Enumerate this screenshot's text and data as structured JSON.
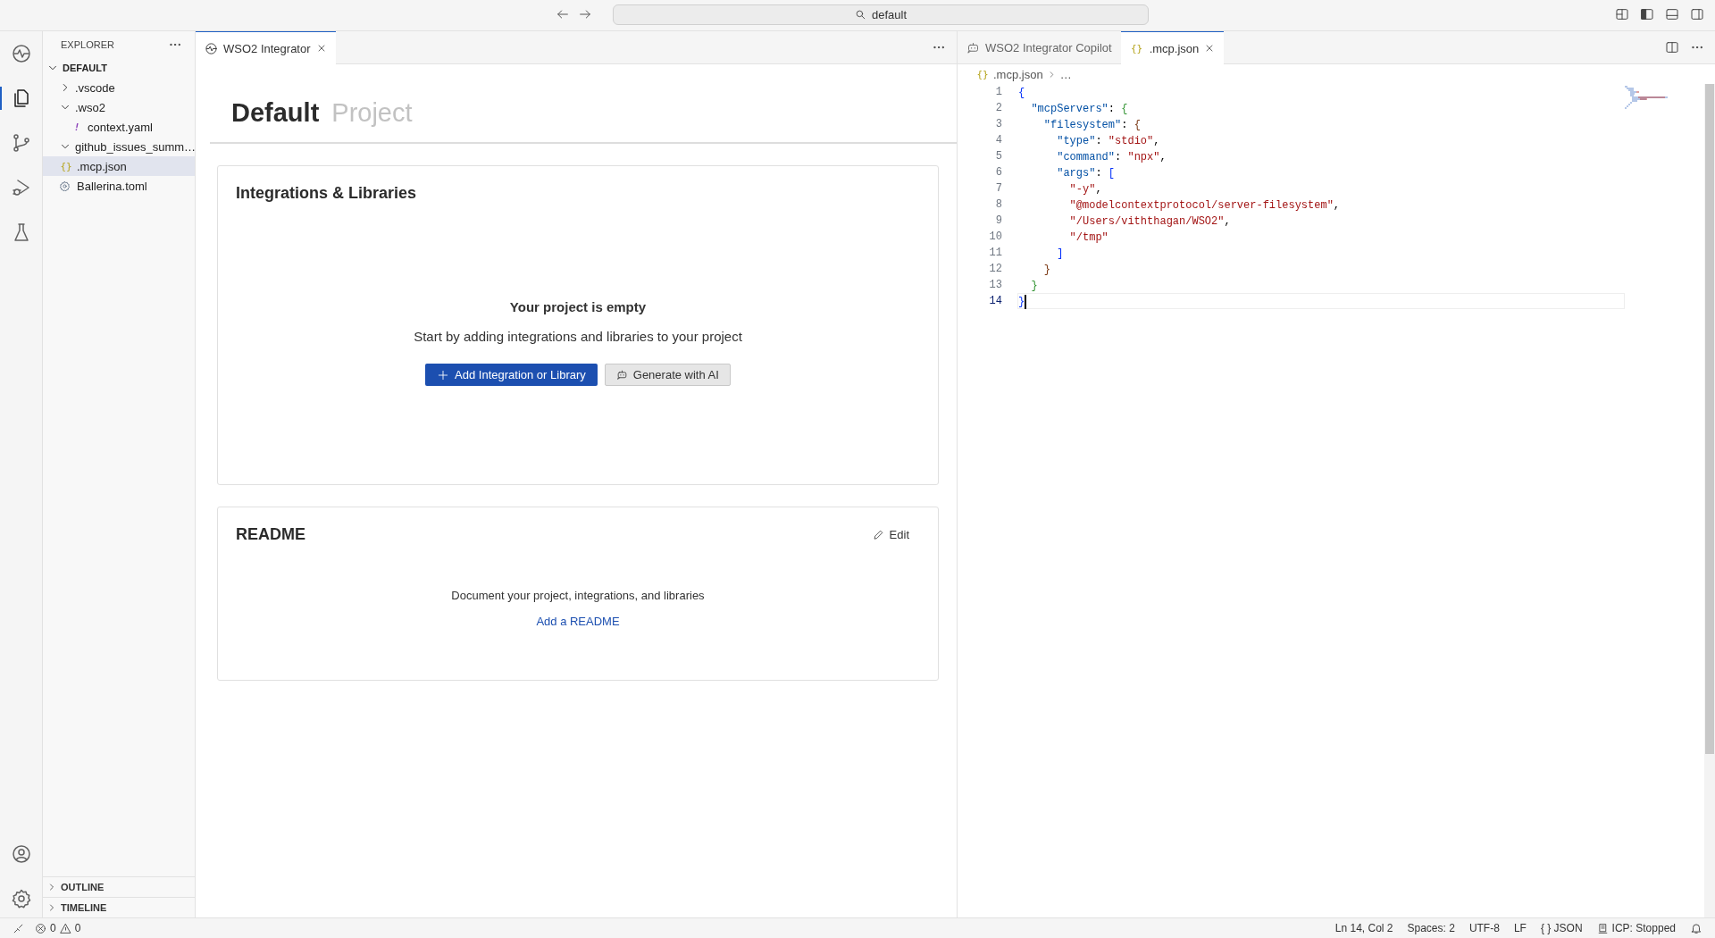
{
  "title_bar": {
    "search": "default"
  },
  "activity_bar": {
    "top": [
      {
        "kind": "integrator",
        "selected": false
      },
      {
        "kind": "explorer",
        "selected": true
      },
      {
        "kind": "source-control",
        "selected": false
      },
      {
        "kind": "run-debug",
        "selected": false
      },
      {
        "kind": "testing",
        "selected": false
      }
    ],
    "bottom": [
      {
        "kind": "account",
        "selected": false
      },
      {
        "kind": "settings",
        "selected": false
      }
    ]
  },
  "sidebar": {
    "title": "EXPLORER",
    "root": {
      "label": "DEFAULT",
      "expanded": true,
      "children": [
        {
          "label": ".vscode",
          "kind": "folder",
          "expanded": false,
          "selected": false
        },
        {
          "label": ".wso2",
          "kind": "folder",
          "expanded": true,
          "selected": false,
          "children": [
            {
              "label": "context.yaml",
              "kind": "yaml",
              "icon": "!",
              "selected": false
            }
          ]
        },
        {
          "label": "github_issues_summ…",
          "kind": "folder",
          "expanded": true,
          "selected": false
        },
        {
          "label": ".mcp.json",
          "kind": "json",
          "icon": "{}",
          "selected": true
        },
        {
          "label": "Ballerina.toml",
          "kind": "toml",
          "selected": false
        }
      ]
    },
    "sections": [
      {
        "label": "OUTLINE",
        "expanded": false
      },
      {
        "label": "TIMELINE",
        "expanded": false
      }
    ]
  },
  "left_editor": {
    "tabs": [
      {
        "label": "WSO2 Integrator",
        "kind": "integrator",
        "selected": true
      }
    ],
    "project": {
      "name": "Default",
      "subtitle": "Project"
    },
    "integrations": {
      "title": "Integrations & Libraries",
      "empty_title": "Your project is empty",
      "empty_text": "Start by adding integrations and libraries to your project",
      "buttons": [
        {
          "label": "Add Integration or Library",
          "kind": "primary"
        },
        {
          "label": "Generate with AI",
          "kind": "secondary"
        }
      ]
    },
    "readme": {
      "title": "README",
      "edit": "Edit",
      "text": "Document your project, integrations, and libraries",
      "link": "Add a README"
    }
  },
  "right_editor": {
    "tabs": [
      {
        "label": "WSO2 Integrator Copilot",
        "kind": "copilot",
        "selected": false
      },
      {
        "label": ".mcp.json",
        "kind": "json",
        "icon": "{}",
        "selected": true
      }
    ],
    "breadcrumb": {
      "icon": "{}",
      "file": ".mcp.json",
      "rest": "…"
    },
    "lines": [
      {
        "number": "1",
        "current": false,
        "tokens": [
          {
            "kind": "bracket1",
            "text": "{"
          }
        ]
      },
      {
        "number": "2",
        "current": false,
        "tokens": [
          {
            "kind": "key",
            "text": "  \"mcpServers\""
          },
          {
            "kind": "punct",
            "text": ": "
          },
          {
            "kind": "bracket2",
            "text": "{"
          }
        ]
      },
      {
        "number": "3",
        "current": false,
        "tokens": [
          {
            "kind": "key",
            "text": "    \"filesystem\""
          },
          {
            "kind": "punct",
            "text": ": "
          },
          {
            "kind": "bracket3",
            "text": "{"
          }
        ]
      },
      {
        "number": "4",
        "current": false,
        "tokens": [
          {
            "kind": "key",
            "text": "      \"type\""
          },
          {
            "kind": "punct",
            "text": ": "
          },
          {
            "kind": "string",
            "text": "\"stdio\""
          },
          {
            "kind": "punct",
            "text": ","
          }
        ]
      },
      {
        "number": "5",
        "current": false,
        "tokens": [
          {
            "kind": "key",
            "text": "      \"command\""
          },
          {
            "kind": "punct",
            "text": ": "
          },
          {
            "kind": "string",
            "text": "\"npx\""
          },
          {
            "kind": "punct",
            "text": ","
          }
        ]
      },
      {
        "number": "6",
        "current": false,
        "tokens": [
          {
            "kind": "key",
            "text": "      \"args\""
          },
          {
            "kind": "punct",
            "text": ": "
          },
          {
            "kind": "bracket1",
            "text": "["
          }
        ]
      },
      {
        "number": "7",
        "current": false,
        "tokens": [
          {
            "kind": "string",
            "text": "        \"-y\""
          },
          {
            "kind": "punct",
            "text": ","
          }
        ]
      },
      {
        "number": "8",
        "current": false,
        "tokens": [
          {
            "kind": "string",
            "text": "        \"@modelcontextprotocol/server-filesystem\""
          },
          {
            "kind": "punct",
            "text": ","
          }
        ]
      },
      {
        "number": "9",
        "current": false,
        "tokens": [
          {
            "kind": "string",
            "text": "        \"/Users/viththagan/WSO2\""
          },
          {
            "kind": "punct",
            "text": ","
          }
        ]
      },
      {
        "number": "10",
        "current": false,
        "tokens": [
          {
            "kind": "string",
            "text": "        \"/tmp\""
          }
        ]
      },
      {
        "number": "11",
        "current": false,
        "tokens": [
          {
            "kind": "bracket1",
            "text": "      ]"
          }
        ]
      },
      {
        "number": "12",
        "current": false,
        "tokens": [
          {
            "kind": "bracket3",
            "text": "    }"
          }
        ]
      },
      {
        "number": "13",
        "current": false,
        "tokens": [
          {
            "kind": "bracket2",
            "text": "  }"
          }
        ]
      },
      {
        "number": "14",
        "current": true,
        "tokens": [
          {
            "kind": "bracket1",
            "text": "}"
          }
        ]
      }
    ]
  },
  "status_bar": {
    "errors": "0",
    "warnings": "0",
    "right": [
      {
        "kind": "text",
        "label": "Ln 14, Col 2"
      },
      {
        "kind": "text",
        "label": "Spaces: 2"
      },
      {
        "kind": "text",
        "label": "UTF-8"
      },
      {
        "kind": "text",
        "label": "LF"
      },
      {
        "kind": "language",
        "icon": "{ }",
        "label": "JSON"
      },
      {
        "kind": "icp",
        "label": "ICP: Stopped"
      }
    ]
  }
}
